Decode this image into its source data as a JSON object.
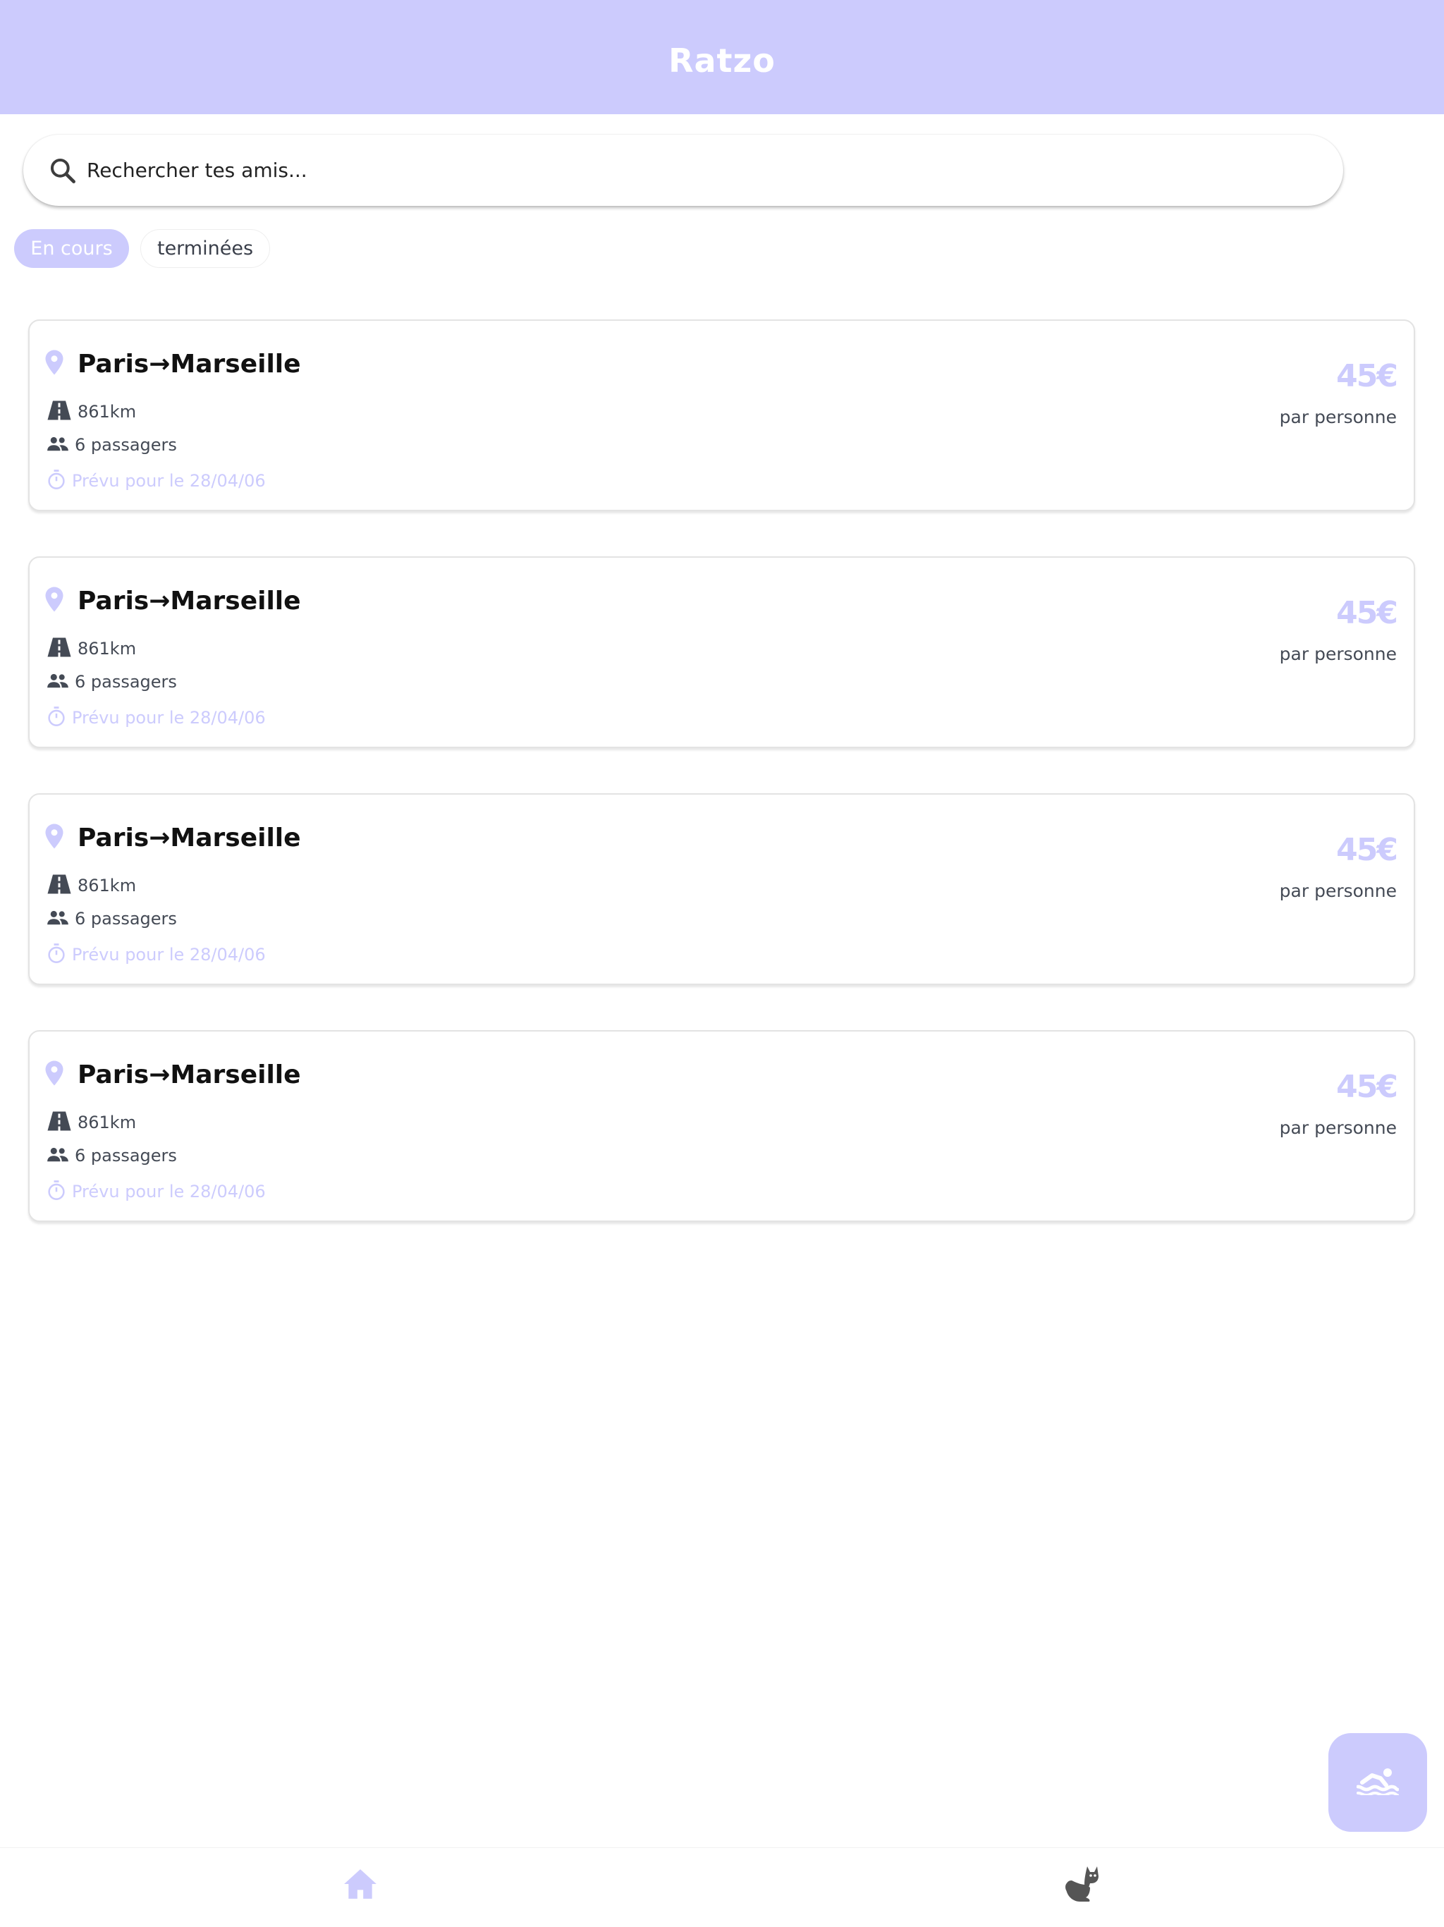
{
  "app": {
    "title": "Ratzo"
  },
  "search": {
    "placeholder": "Rechercher tes amis..."
  },
  "filters": {
    "active": "En cours",
    "inactive": "terminées"
  },
  "trips": [
    {
      "route": "Paris→Marseille",
      "distance": "861km",
      "passengers": "6 passagers",
      "date": "Prévu pour le 28/04/06",
      "price": "45€",
      "price_unit": "par personne"
    },
    {
      "route": "Paris→Marseille",
      "distance": "861km",
      "passengers": "6 passagers",
      "date": "Prévu pour le 28/04/06",
      "price": "45€",
      "price_unit": "par personne"
    },
    {
      "route": "Paris→Marseille",
      "distance": "861km",
      "passengers": "6 passagers",
      "date": "Prévu pour le 28/04/06",
      "price": "45€",
      "price_unit": "par personne"
    },
    {
      "route": "Paris→Marseille",
      "distance": "861km",
      "passengers": "6 passagers",
      "date": "Prévu pour le 28/04/06",
      "price": "45€",
      "price_unit": "par personne"
    }
  ],
  "icons": {
    "search": "search-icon",
    "location": "location-pin-icon",
    "road": "road-icon",
    "passengers": "people-icon",
    "timer": "timer-icon",
    "fab": "swimming-icon",
    "home": "home-icon",
    "cat": "cat-icon"
  },
  "colors": {
    "accent": "#cccbfd",
    "text": "#111111",
    "muted": "#444a55",
    "white": "#ffffff"
  }
}
